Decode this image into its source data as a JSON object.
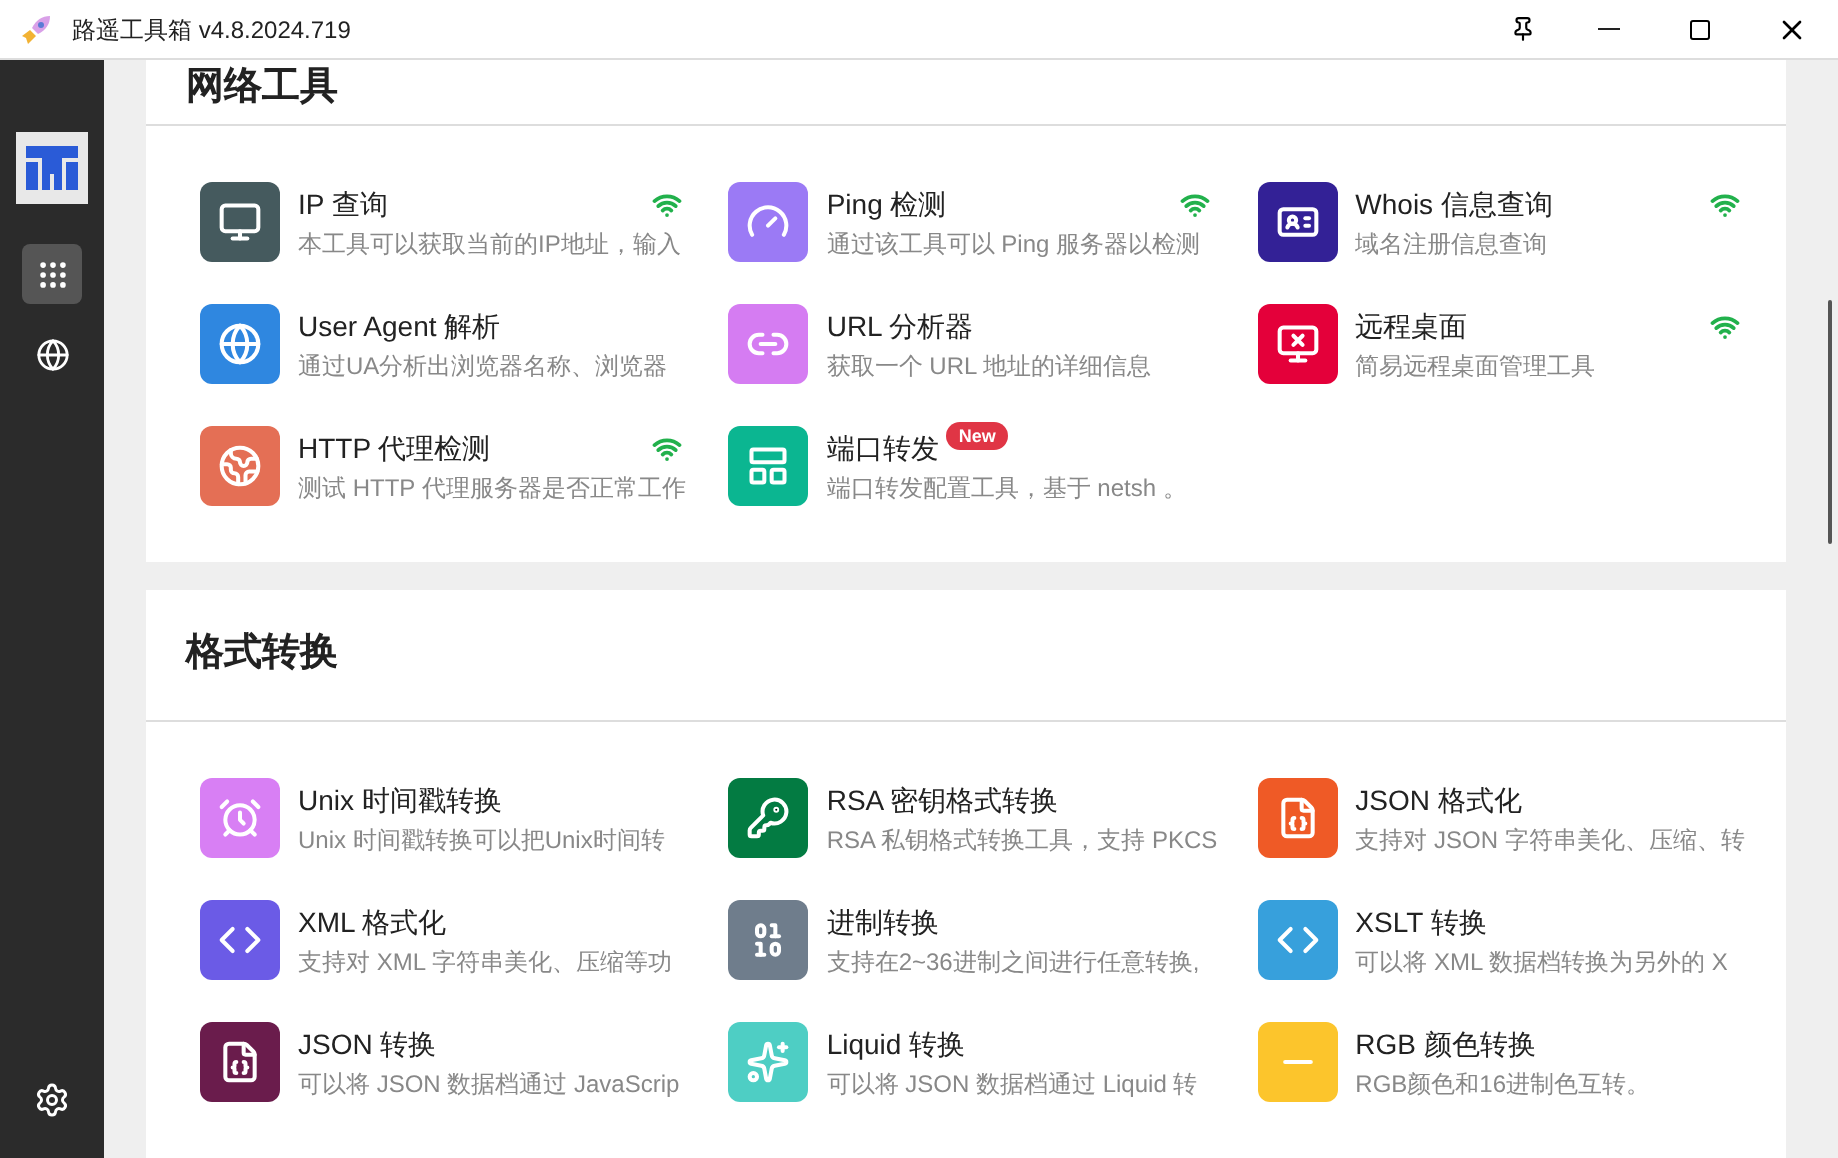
{
  "window": {
    "title": "路遥工具箱 v4.8.2024.719"
  },
  "sidebar": {
    "items": [
      {
        "selected": true
      },
      {
        "selected": false
      }
    ]
  },
  "sections": [
    {
      "title": "网络工具",
      "items": [
        {
          "name": "IP 查询",
          "desc": "本工具可以获取当前的IP地址，输入",
          "color": "#455a5e",
          "online": true
        },
        {
          "name": "Ping 检测",
          "desc": "通过该工具可以 Ping 服务器以检测",
          "color": "#9b7af5",
          "online": true
        },
        {
          "name": "Whois 信息查询",
          "desc": "域名注册信息查询",
          "color": "#332196",
          "online": true
        },
        {
          "name": "User Agent 解析",
          "desc": "通过UA分析出浏览器名称、浏览器",
          "color": "#2f87e0",
          "online": false
        },
        {
          "name": "URL 分析器",
          "desc": "获取一个 URL 地址的详细信息",
          "color": "#d57cf2",
          "online": false
        },
        {
          "name": "远程桌面",
          "desc": "简易远程桌面管理工具",
          "color": "#e4003a",
          "online": true
        },
        {
          "name": "HTTP 代理检测",
          "desc": "测试 HTTP 代理服务器是否正常工作",
          "color": "#e46f55",
          "online": true
        },
        {
          "name": "端口转发",
          "desc": "端口转发配置工具，基于 netsh 。",
          "color": "#0bb691",
          "online": false,
          "badge": "New"
        }
      ]
    },
    {
      "title": "格式转换",
      "items": [
        {
          "name": "Unix 时间戳转换",
          "desc": "Unix 时间戳转换可以把Unix时间转",
          "color": "#d87ff4",
          "online": false
        },
        {
          "name": "RSA 密钥格式转换",
          "desc": "RSA 私钥格式转换工具，支持 PKCS",
          "color": "#037b42",
          "online": false
        },
        {
          "name": "JSON 格式化",
          "desc": "支持对 JSON 字符串美化、压缩、转",
          "color": "#ef5a26",
          "online": false
        },
        {
          "name": "XML 格式化",
          "desc": "支持对 XML 字符串美化、压缩等功",
          "color": "#6b5be6",
          "online": false
        },
        {
          "name": "进制转换",
          "desc": "支持在2~36进制之间进行任意转换,",
          "color": "#6f7d8c",
          "online": false
        },
        {
          "name": "XSLT 转换",
          "desc": "可以将 XML 数据档转换为另外的 X",
          "color": "#37a0dc",
          "online": false
        },
        {
          "name": "JSON 转换",
          "desc": "可以将 JSON 数据档通过 JavaScrip",
          "color": "#6a1c4c",
          "online": false
        },
        {
          "name": "Liquid 转换",
          "desc": "可以将 JSON 数据档通过 Liquid 转",
          "color": "#4ecec4",
          "online": false
        },
        {
          "name": "RGB 颜色转换",
          "desc": "RGB颜色和16进制色互转。",
          "color": "#fcc52c",
          "online": false
        }
      ]
    }
  ]
}
